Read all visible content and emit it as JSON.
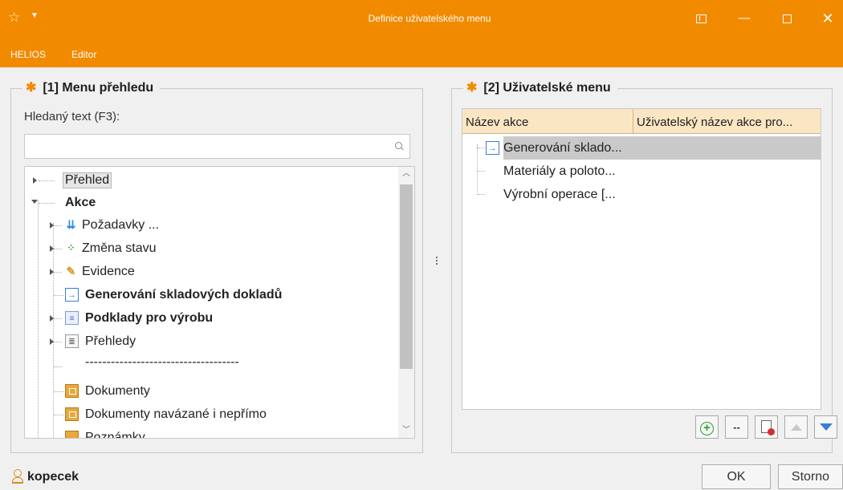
{
  "window": {
    "title": "Definice uživatelského menu",
    "icons": [
      "app-star-icon",
      "quick-access-icon",
      "pin-icon",
      "minimize-icon",
      "maximize-icon",
      "close-icon"
    ],
    "accent_color": "#f28a00"
  },
  "menubar": {
    "items": [
      "HELIOS",
      "Editor"
    ]
  },
  "left_panel": {
    "title": "[1] Menu přehledu",
    "search_label": "Hledaný text (F3):",
    "search_value": "",
    "tree": [
      {
        "label": "Přehled",
        "level": 0,
        "expander": "collapsed",
        "bold": false,
        "icon": null,
        "highlighted": true
      },
      {
        "label": "Akce",
        "level": 0,
        "expander": "expanded",
        "bold": true,
        "icon": null
      },
      {
        "label": "Požadavky ...",
        "level": 1,
        "expander": "collapsed",
        "bold": false,
        "icon": "stack-icon"
      },
      {
        "label": "Změna stavu",
        "level": 1,
        "expander": "collapsed",
        "bold": false,
        "icon": "workflow-icon"
      },
      {
        "label": "Evidence",
        "level": 1,
        "expander": "collapsed",
        "bold": false,
        "icon": "pencil-icon"
      },
      {
        "label": "Generování skladových dokladů",
        "level": 1,
        "expander": null,
        "bold": true,
        "icon": "arrow-document-icon"
      },
      {
        "label": "Podklady pro výrobu",
        "level": 1,
        "expander": "collapsed",
        "bold": true,
        "icon": "book-icon"
      },
      {
        "label": "Přehledy",
        "level": 1,
        "expander": "collapsed",
        "bold": false,
        "icon": "list-icon"
      },
      {
        "label": "------------------------------------",
        "level": 1,
        "expander": null,
        "bold": false,
        "icon": null
      },
      {
        "label": "Dokumenty",
        "level": 1,
        "expander": null,
        "bold": false,
        "icon": "folder-icon"
      },
      {
        "label": "Dokumenty navázané i nepřímo",
        "level": 1,
        "expander": null,
        "bold": false,
        "icon": "folder-icon"
      },
      {
        "label": "Poznámky",
        "level": 1,
        "expander": null,
        "bold": false,
        "icon": "note-icon"
      }
    ]
  },
  "right_panel": {
    "title": "[2] Uživatelské menu",
    "columns": [
      "Název akce",
      "Uživatelský název akce pro..."
    ],
    "rows": [
      {
        "name": "Generování sklado...",
        "user_name": "",
        "selected": true,
        "icon": "arrow-document-icon"
      },
      {
        "name": "Materiály a poloto...",
        "user_name": "",
        "selected": false,
        "icon": null
      },
      {
        "name": "Výrobní operace [...",
        "user_name": "",
        "selected": false,
        "icon": null
      }
    ],
    "toolbar": {
      "add_icon": "add-circle-icon",
      "separator_label": "--",
      "delete_icon": "delete-document-icon",
      "up_icon": "move-up-icon",
      "down_icon": "move-down-icon"
    }
  },
  "status": {
    "user": "kopecek",
    "user_icon": "user-icon"
  },
  "buttons": {
    "ok": "OK",
    "cancel": "Storno"
  }
}
